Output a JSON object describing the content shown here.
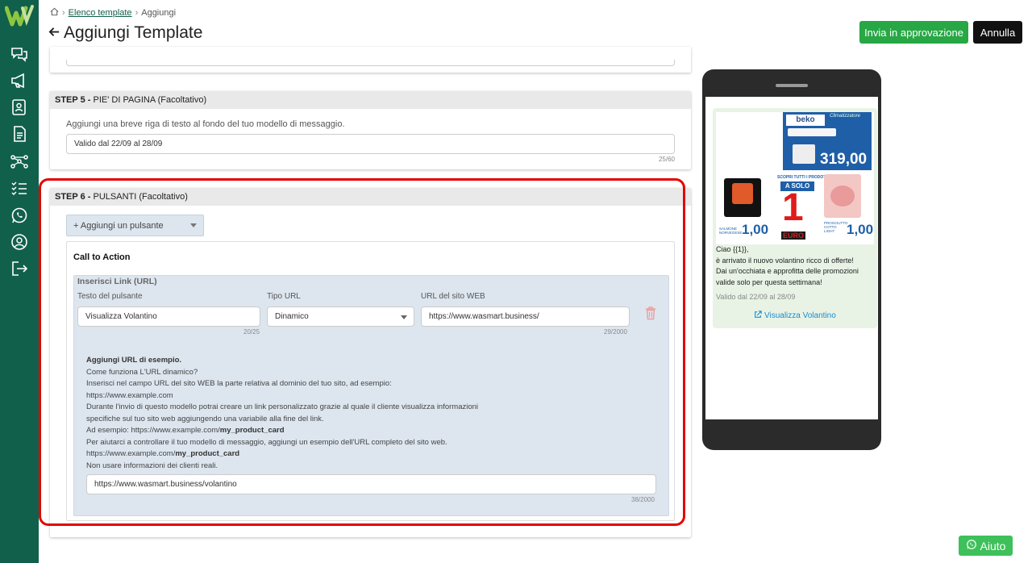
{
  "sidebar": {
    "logo": "wasmart-logo",
    "items": [
      "chat-icon",
      "megaphone-icon",
      "contacts-icon",
      "document-icon",
      "flow-icon",
      "checklist-icon",
      "whatsapp-icon",
      "user-icon",
      "logout-icon"
    ]
  },
  "breadcrumb": {
    "link": "Elenco template",
    "current": "Aggiungi"
  },
  "header": {
    "title": "Aggiungi Template",
    "submit_label": "Invia in approvazione",
    "cancel_label": "Annulla"
  },
  "step5": {
    "step": "STEP 5 -",
    "title": "PIE' DI PAGINA (Facoltativo)",
    "description": "Aggiungi una breve riga di testo al fondo del tuo modello di messaggio.",
    "value": "Valido dal 22/09 al 28/09",
    "counter": "25/60"
  },
  "step6": {
    "step": "STEP 6 -",
    "title": "PULSANTI (Facoltativo)",
    "add_button": "+ Aggiungi un pulsante",
    "section_title": "Call to Action",
    "panel_title": "Inserisci Link (URL)",
    "button_text_label": "Testo del pulsante",
    "button_text_value": "Visualizza Volantino",
    "button_text_counter": "20/25",
    "url_type_label": "Tipo URL",
    "url_type_value": "Dinamico",
    "site_url_label": "URL del sito WEB",
    "site_url_value": "https://www.wasmart.business/",
    "site_url_counter": "29/2000",
    "help": {
      "title": "Aggiungi URL di esempio.",
      "l1": "Come funziona L'URL dinamico?",
      "l2": "Inserisci nel campo URL del sito WEB la parte relativa al dominio del tuo sito, ad esempio:",
      "l3": "https://www.example.com",
      "l4": "Durante l'invio di questo modello potrai creare un link personalizzato grazie al quale il cliente visualizza informazioni",
      "l5": "specifiche sul tuo sito web aggiungendo una variabile alla fine del link.",
      "l6a": "Ad esempio: https://www.example.com/",
      "l6b": "my_product_card",
      "l7": "Per aiutarci a controllare il tuo modello di messaggio, aggiungi un esempio dell'URL completo del sito web.",
      "l8a": "https://www.example.com/",
      "l8b": "my_product_card",
      "l9": "Non usare informazioni dei clienti reali."
    },
    "example_url_value": "https://www.wasmart.business/volantino",
    "example_url_counter": "38/2000"
  },
  "preview": {
    "promo": {
      "brand": "beko",
      "banner": "Climatizzatore",
      "price_main": "319,00",
      "tag1": "SCOPRI TUTTI I PRODOTTI",
      "a_solo": "A SOLO",
      "one": "1",
      "euro": "EURO",
      "price_small_1": "1,00",
      "price_small_2": "1,00",
      "cad": "€ 1",
      "label_salmone": "SALMONE NORVEGESE",
      "label_prosciutto": "PROSCIUTTO COTTO LIGHT"
    },
    "message_l1": "Ciao {{1}},",
    "message_l2": "è arrivato il nuovo volantino ricco di offerte!",
    "message_l3": "Dai un'occhiata e approfitta delle promozioni",
    "message_l4": "valide solo per questa settimana!",
    "footer": "Valido dal 22/09 al 28/09",
    "button": "Visualizza Volantino"
  },
  "help_button": "Aiuto",
  "colors": {
    "brand": "#11604b",
    "primary": "#28a745",
    "highlight": "#e50000",
    "link": "#1a8bd1"
  }
}
